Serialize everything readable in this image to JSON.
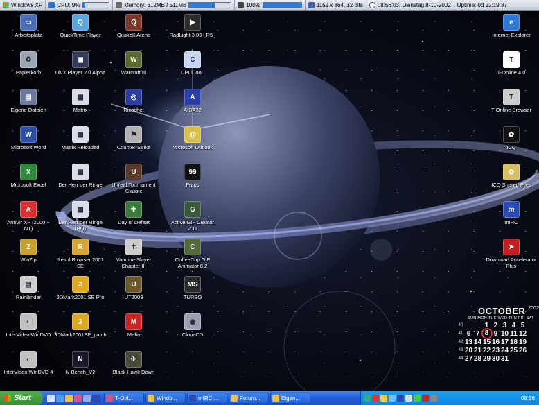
{
  "topbar": {
    "os": "Windows XP",
    "cpu": "CPU: 9%",
    "cpu_level_percent": 9,
    "memory": "Memory: 312MB / 511MB",
    "memory_level_percent": 61,
    "volume": "100%",
    "volume_level_percent": 100,
    "resolution": "1152 x 864, 32 bits",
    "datetime": "08:56:03, Dienstag 8-10-2002",
    "uptime": "Uptime: 0d 22:19:37"
  },
  "icons": [
    {
      "label": "Arbeitsplatz",
      "icon": "my-computer-icon",
      "color": "#4a6fb8",
      "glyph": "▭"
    },
    {
      "label": "QuickTime Player",
      "icon": "quicktime-icon",
      "color": "#5aa7e0",
      "glyph": "Q"
    },
    {
      "label": "QuakeIIIArena",
      "icon": "quake-icon",
      "color": "#7a3a2a",
      "glyph": "Q"
    },
    {
      "label": "RadLight 3.03 [ R5 ]",
      "icon": "radlight-icon",
      "color": "#2c2c2c",
      "glyph": "▶"
    },
    {
      "label": "Papierkorb",
      "icon": "recycle-bin-icon",
      "color": "#9aa5b2",
      "glyph": "♻"
    },
    {
      "label": "DivX Player 2.0 Alpha",
      "icon": "divx-icon",
      "color": "#333a55",
      "glyph": "▣"
    },
    {
      "label": "Warcraft III",
      "icon": "warcraft-icon",
      "color": "#5a6a2c",
      "glyph": "W"
    },
    {
      "label": "CPUCooL",
      "icon": "cpucool-icon",
      "color": "#c8d4f0",
      "glyph": "C"
    },
    {
      "label": "Eigene Dateien",
      "icon": "documents-folder-icon",
      "color": "#6d7aa0",
      "glyph": "▤"
    },
    {
      "label": "Matrix",
      "icon": "matrix-icon",
      "color": "#d8dde8",
      "glyph": "▦"
    },
    {
      "label": "Ricochet",
      "icon": "ricochet-icon",
      "color": "#2a3fa0",
      "glyph": "◎"
    },
    {
      "label": "AIDA32",
      "icon": "aida-icon",
      "color": "#2c3ea8",
      "glyph": "A"
    },
    {
      "label": "Microsoft Word",
      "icon": "word-icon",
      "color": "#2c4fa8",
      "glyph": "W"
    },
    {
      "label": "Matrix Reloaded",
      "icon": "matrix-reloaded-icon",
      "color": "#d8dde8",
      "glyph": "▦"
    },
    {
      "label": "Counter-Strike",
      "icon": "counter-strike-icon",
      "color": "#b0b0b0",
      "glyph": "⚑"
    },
    {
      "label": "Microsoft Outlook",
      "icon": "outlook-icon",
      "color": "#d9c04a",
      "glyph": "@"
    },
    {
      "label": "Microsoft Excel",
      "icon": "excel-icon",
      "color": "#2f8a3c",
      "glyph": "X"
    },
    {
      "label": "Der Herr der Ringe",
      "icon": "movie-icon",
      "color": "#d8dde8",
      "glyph": "▦"
    },
    {
      "label": "Unreal Tournament Classic",
      "icon": "unreal-icon",
      "color": "#5a3a2a",
      "glyph": "U"
    },
    {
      "label": "Fraps",
      "icon": "fraps-icon",
      "color": "#111111",
      "glyph": "99"
    },
    {
      "label": "AntiVir XP (2000 + NT)",
      "icon": "antivir-icon",
      "color": "#d83030",
      "glyph": "A"
    },
    {
      "label": "Der Herr der Ringe (HQ)",
      "icon": "movie-hq-icon",
      "color": "#d8dde8",
      "glyph": "▦"
    },
    {
      "label": "Day of Defeat",
      "icon": "day-of-defeat-icon",
      "color": "#3a7a3a",
      "glyph": "✚"
    },
    {
      "label": "Active GIF Creator 2.11",
      "icon": "gif-creator-icon",
      "color": "#3a5a3a",
      "glyph": "G"
    },
    {
      "label": "WinZip",
      "icon": "winzip-icon",
      "color": "#c8a030",
      "glyph": "Z"
    },
    {
      "label": "ResultBrowser 2001 SE",
      "icon": "resultbrowser-icon",
      "color": "#d6a630",
      "glyph": "R"
    },
    {
      "label": "Vampire Slayer Chapter III",
      "icon": "vampire-slayer-icon",
      "color": "#cccccc",
      "glyph": "✝"
    },
    {
      "label": "CoffeeCup GIF Animator 6.2",
      "icon": "coffeecup-icon",
      "color": "#556a3a",
      "glyph": "C"
    },
    {
      "label": "Rainlendar",
      "icon": "rainlendar-icon",
      "color": "#cccccc",
      "glyph": "▤"
    },
    {
      "label": "3DMark2001 SE Pro",
      "icon": "3dmark-icon",
      "color": "#e0a820",
      "glyph": "3"
    },
    {
      "label": "UT2003",
      "icon": "ut2003-icon",
      "color": "#6a5a2a",
      "glyph": "U"
    },
    {
      "label": "TURBO",
      "icon": "turbo-icon",
      "color": "#2a2a2a",
      "glyph": "MS"
    },
    {
      "label": "InterVideo WinDVD",
      "icon": "windvd-icon",
      "color": "#c0c0c0",
      "glyph": "◐"
    },
    {
      "label": "3DMark2001SE_patch",
      "icon": "3dmark-patch-icon",
      "color": "#e0a820",
      "glyph": "3"
    },
    {
      "label": "Mafia",
      "icon": "mafia-icon",
      "color": "#cc2222",
      "glyph": "M"
    },
    {
      "label": "CloneCD",
      "icon": "clonecd-icon",
      "color": "#9aa0b0",
      "glyph": "◉"
    },
    {
      "label": "InterVideo WinDVD 4",
      "icon": "windvd4-icon",
      "color": "#c0c0c0",
      "glyph": "◐"
    },
    {
      "label": "N-Bench_V2",
      "icon": "nbench-icon",
      "color": "#1a1a2a",
      "glyph": "N"
    },
    {
      "label": "Black Hawk Down",
      "icon": "black-hawk-down-icon",
      "color": "#4a4a3a",
      "glyph": "✈"
    },
    {
      "label": "Internet Explorer",
      "icon": "internet-explorer-icon",
      "color": "#2f7ad6",
      "glyph": "e"
    },
    {
      "label": "T-Online 4.0",
      "icon": "t-online-icon",
      "color": "#ffffff",
      "glyph": "T"
    },
    {
      "label": "T-Online Browser",
      "icon": "t-online-browser-icon",
      "color": "#cccccc",
      "glyph": "T"
    },
    {
      "label": "ICQ",
      "icon": "icq-icon",
      "color": "#111111",
      "glyph": "✿"
    },
    {
      "label": "ICQ Shared Files",
      "icon": "icq-shared-folder-icon",
      "color": "#d8c060",
      "glyph": "✿"
    },
    {
      "label": "mIRC",
      "icon": "mirc-icon",
      "color": "#2a4ab0",
      "glyph": "m"
    },
    {
      "label": "Download Accelerator Plus",
      "icon": "download-accelerator-icon",
      "color": "#c02020",
      "glyph": "➤"
    }
  ],
  "calendar": {
    "month": "OCTOBER",
    "year": "2002",
    "header": "SUN MON TUE WED THU FRI SAT",
    "weeks": [
      {
        "wk": "40",
        "days": [
          "",
          "",
          "1",
          "2",
          "3",
          "4",
          "5"
        ]
      },
      {
        "wk": "41",
        "days": [
          "6",
          "7",
          "8",
          "9",
          "10",
          "11",
          "12"
        ]
      },
      {
        "wk": "42",
        "days": [
          "13",
          "14",
          "15",
          "16",
          "17",
          "18",
          "19"
        ]
      },
      {
        "wk": "43",
        "days": [
          "20",
          "21",
          "22",
          "23",
          "24",
          "25",
          "26"
        ]
      },
      {
        "wk": "44",
        "days": [
          "27",
          "28",
          "29",
          "30",
          "31",
          "",
          ""
        ]
      }
    ],
    "today": "8"
  },
  "taskbar": {
    "start_label": "Start",
    "tasks": [
      "T-Onl...",
      "Windo...",
      "mIRC ...",
      "Forum...",
      "Eigen..."
    ],
    "clock": "08:56"
  }
}
